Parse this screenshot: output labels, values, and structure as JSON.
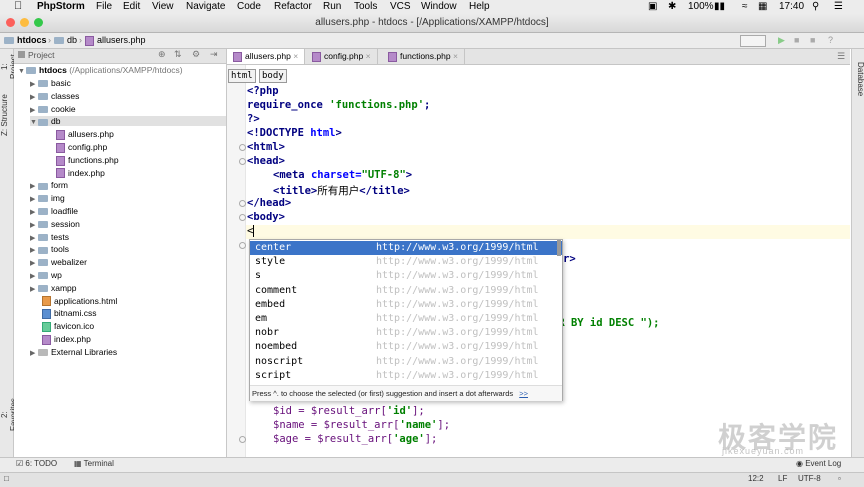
{
  "menubar": {
    "app": "PhpStorm",
    "items": [
      "File",
      "Edit",
      "View",
      "Navigate",
      "Code",
      "Refactor",
      "Run",
      "Tools",
      "VCS",
      "Window",
      "Help"
    ],
    "battery": "100%",
    "time": "17:40"
  },
  "window": {
    "title": "allusers.php - htdocs - [/Applications/XAMPP/htdocs]"
  },
  "breadcrumbs": [
    "htdocs",
    "db",
    "allusers.php"
  ],
  "project_panel": {
    "title": "Project",
    "root": "htdocs",
    "root_path": "(/Applications/XAMPP/htdocs)",
    "items": [
      {
        "label": "basic",
        "type": "folder"
      },
      {
        "label": "classes",
        "type": "folder"
      },
      {
        "label": "cookie",
        "type": "folder"
      },
      {
        "label": "db",
        "type": "folder-open"
      },
      {
        "label": "allusers.php",
        "type": "php"
      },
      {
        "label": "config.php",
        "type": "php"
      },
      {
        "label": "functions.php",
        "type": "php"
      },
      {
        "label": "index.php",
        "type": "php"
      },
      {
        "label": "form",
        "type": "folder"
      },
      {
        "label": "img",
        "type": "folder"
      },
      {
        "label": "loadfile",
        "type": "folder"
      },
      {
        "label": "session",
        "type": "folder"
      },
      {
        "label": "tests",
        "type": "folder"
      },
      {
        "label": "tools",
        "type": "folder"
      },
      {
        "label": "webalizer",
        "type": "folder"
      },
      {
        "label": "wp",
        "type": "folder"
      },
      {
        "label": "xampp",
        "type": "folder"
      },
      {
        "label": "applications.html",
        "type": "html"
      },
      {
        "label": "bitnami.css",
        "type": "css"
      },
      {
        "label": "favicon.ico",
        "type": "ico"
      },
      {
        "label": "index.php",
        "type": "php"
      },
      {
        "label": "External Libraries",
        "type": "lib"
      }
    ]
  },
  "side_labels": {
    "project": "1: Project",
    "structure": "Z: Structure",
    "favorites": "2: Favorites",
    "database": "Database"
  },
  "tabs": [
    "allusers.php",
    "config.php",
    "functions.php"
  ],
  "editor_breadcrumb": [
    "html",
    "body"
  ],
  "code": {
    "l1": "<?php",
    "l2a": "require_once ",
    "l2b": "'functions.php'",
    "l2c": ";",
    "l3": "?>",
    "l4a": "<!DOCTYPE ",
    "l4b": "html",
    "l4c": ">",
    "l5": "<html>",
    "l6": "<head>",
    "l7a": "<meta ",
    "l7b": "charset=",
    "l7c": "\"UTF-8\"",
    "l7d": ">",
    "l8a": "<title>",
    "l8b": "所有用户",
    "l8c": "</title>",
    "l9": "</head>",
    "l10": "<body>",
    "l11": "<",
    "frag_r": "r>",
    "frag_desc": "ER BY id DESC \");",
    "l_id_a": "$id = $result_arr[",
    "l_id_b": "'id'",
    "l_id_c": "];",
    "l_name_a": "$name = $result_arr[",
    "l_name_b": "'name'",
    "l_name_c": "];",
    "l_age_a": "$age = $result_arr[",
    "l_age_b": "'age'",
    "l_age_c": "];"
  },
  "completion": {
    "items": [
      {
        "name": "center",
        "url": "http://www.w3.org/1999/html"
      },
      {
        "name": "style",
        "url": "http://www.w3.org/1999/html"
      },
      {
        "name": "s",
        "url": "http://www.w3.org/1999/html"
      },
      {
        "name": "comment",
        "url": "http://www.w3.org/1999/html"
      },
      {
        "name": "embed",
        "url": "http://www.w3.org/1999/html"
      },
      {
        "name": "em",
        "url": "http://www.w3.org/1999/html"
      },
      {
        "name": "nobr",
        "url": "http://www.w3.org/1999/html"
      },
      {
        "name": "noembed",
        "url": "http://www.w3.org/1999/html"
      },
      {
        "name": "noscript",
        "url": "http://www.w3.org/1999/html"
      },
      {
        "name": "script",
        "url": "http://www.w3.org/1999/html"
      }
    ],
    "footer": "Press ^. to choose the selected (or first) suggestion and insert a dot afterwards",
    "footer_link": ">>"
  },
  "bottom_tools": {
    "todo": "6: TODO",
    "terminal": "Terminal",
    "event_log": "Event Log"
  },
  "status": {
    "position": "12:2",
    "line_sep": "LF",
    "encoding": "UTF-8"
  },
  "watermark": {
    "text": "极客学院",
    "sub": "jikexueyuan.com"
  }
}
